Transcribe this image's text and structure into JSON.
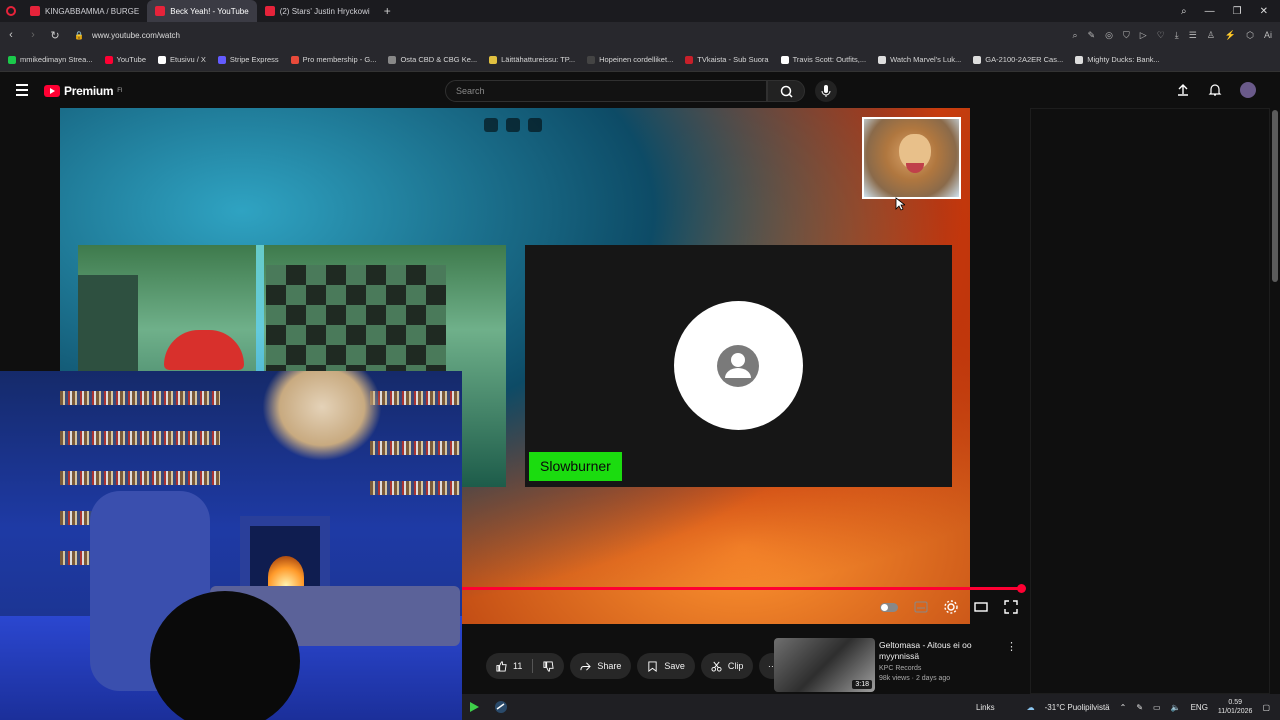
{
  "browser": {
    "tabs": [
      {
        "label": "KINGABBAMMA / BURGE",
        "active": false
      },
      {
        "label": "Beck Yeah! - YouTube",
        "active": true
      },
      {
        "label": "(2) Stars' Justin Hryckowi",
        "active": false
      }
    ],
    "new_tab_symbol": "+",
    "url": "www.youtube.com/watch",
    "bookmarks": [
      {
        "label": "mmikedimayn Strea...",
        "color": "#1bc94b"
      },
      {
        "label": "YouTube",
        "color": "#ff0033"
      },
      {
        "label": "Etusivu / X",
        "color": "#ffffff"
      },
      {
        "label": "Stripe Express",
        "color": "#635bff"
      },
      {
        "label": "Pro membership - G...",
        "color": "#e84a3a"
      },
      {
        "label": "Osta CBD & CBG Ke...",
        "color": "#888888"
      },
      {
        "label": "Läittähattureissu: TP...",
        "color": "#e0c040"
      },
      {
        "label": "Hopeinen cordelliket...",
        "color": "#444444"
      },
      {
        "label": "TVkaista - Sub Suora",
        "color": "#c8202a"
      },
      {
        "label": "Travis Scott: Outfits,...",
        "color": "#ffffff"
      },
      {
        "label": "Watch Marvel's Luk...",
        "color": "#dddddd"
      },
      {
        "label": "GA-2100-2A2ER Cas...",
        "color": "#dddddd"
      },
      {
        "label": "Mighty Ducks: Bank...",
        "color": "#dddddd"
      }
    ]
  },
  "youtube": {
    "logo_text": "Premium",
    "logo_superscript": "FI",
    "search_placeholder": "Search",
    "brand_color": "#ff0033"
  },
  "player": {
    "caller_name": "Slowburner",
    "caller_badge_color": "#1bdc0f",
    "progress_fraction": 0.98,
    "icons": [
      "pip-icon",
      "effects-icon",
      "camera-icon"
    ],
    "controls": [
      "autoplay-toggle",
      "subtitles-icon",
      "settings-icon",
      "theater-icon",
      "fullscreen-icon"
    ]
  },
  "actions": {
    "like_count": "11",
    "share_label": "Share",
    "save_label": "Save",
    "clip_label": "Clip",
    "more_symbol": "···"
  },
  "recommendation": {
    "title": "Geltomasa - Aitous ei oo myynnissä",
    "channel": "KPC Records",
    "meta": "98k views · 2 days ago",
    "duration": "3:18"
  },
  "taskbar": {
    "links_label": "Links",
    "weather": "-31°C  Puolipilvistä",
    "language": "ENG",
    "time": "0.59",
    "date": "11/01/2026"
  }
}
